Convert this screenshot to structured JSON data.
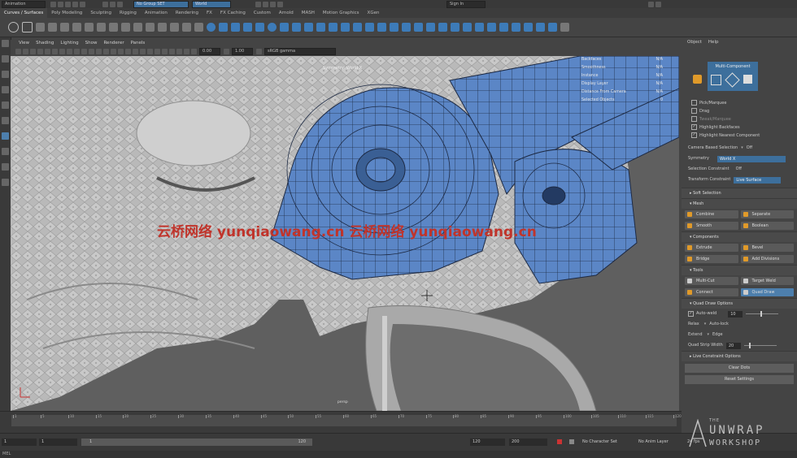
{
  "status": {
    "mode": "Animation",
    "selection_set": "No Group SET",
    "space": "World",
    "sign_in": "Sign In"
  },
  "shelf_tabs": [
    "Curves / Surfaces",
    "Poly Modeling",
    "Sculpting",
    "Rigging",
    "Animation",
    "Rendering",
    "FX",
    "FX Caching",
    "Custom",
    "Arnold",
    "MASH",
    "Motion Graphics",
    "XGen"
  ],
  "viewport_menu": [
    "View",
    "Shading",
    "Lighting",
    "Show",
    "Renderer",
    "Panels"
  ],
  "viewport_toolbar": {
    "value1": "0.00",
    "value2": "1.00",
    "color_space": "sRGB gamma"
  },
  "hud": [
    {
      "label": "Backfaces",
      "value": "N/A"
    },
    {
      "label": "Smoothness",
      "value": "N/A"
    },
    {
      "label": "Instance",
      "value": "N/A"
    },
    {
      "label": "Display Layer",
      "value": "N/A"
    },
    {
      "label": "Distance From Camera",
      "value": "N/A"
    },
    {
      "label": "Selected Objects",
      "value": "0"
    }
  ],
  "symmetry_label": "Symmetry: World X",
  "camera_name": "persp",
  "watermark": "云桥网络 yunqiaowang.cn 云桥网络 yunqiaowang.cn",
  "panel": {
    "menu": [
      "Object",
      "Help"
    ],
    "mode_title": "Multi-Component",
    "pick_options": [
      {
        "label": "Pick/Marquee",
        "checked": false,
        "dim": false
      },
      {
        "label": "Drag",
        "checked": false,
        "dim": false
      },
      {
        "label": "Tweak/Marquee",
        "checked": false,
        "dim": true
      },
      {
        "label": "Highlight Backfaces",
        "checked": true,
        "dim": false
      },
      {
        "label": "Highlight Nearest Component",
        "checked": true,
        "dim": false
      }
    ],
    "camera_based": {
      "label": "Camera Based Selection",
      "value": "Off"
    },
    "symmetry": {
      "label": "Symmetry",
      "value": "World X"
    },
    "selection_constraint": {
      "label": "Selection Constraint",
      "value": "Off"
    },
    "transform_constraint": {
      "label": "Transform Constraint",
      "value": "Live Surface"
    },
    "soft_selection": "Soft Selection",
    "mesh": {
      "title": "Mesh",
      "buttons": [
        "Combine",
        "Separate",
        "Smooth",
        "Boolean"
      ]
    },
    "components": {
      "title": "Components",
      "buttons": [
        "Extrude",
        "Bevel",
        "Bridge",
        "Add Divisions"
      ]
    },
    "tools": {
      "title": "Tools",
      "buttons": [
        "Multi-Cut",
        "Target Weld",
        "Connect",
        "Quad Draw"
      ]
    },
    "quad_draw": {
      "title": "Quad Draw Options",
      "auto_weld_label": "Auto-weld",
      "auto_weld_value": "10",
      "relax_label": "Relax",
      "relax_value": "Auto-lock",
      "extend_label": "Extend",
      "extend_value": "Edge",
      "strip_label": "Quad Strip Width",
      "strip_value": "20"
    },
    "live_constraint": "Live Constraint Options",
    "clear_dots": "Clear Dots",
    "reset_settings": "Reset Settings"
  },
  "timeline": {
    "ticks": [
      "1",
      "5",
      "10",
      "15",
      "20",
      "25",
      "30",
      "35",
      "40",
      "45",
      "50",
      "55",
      "60",
      "65",
      "70",
      "75",
      "80",
      "85",
      "90",
      "95",
      "100",
      "105",
      "110",
      "115",
      "120"
    ],
    "range_start": "1",
    "anim_start": "1",
    "slider_start": "1",
    "slider_end": "120",
    "range_end": "120",
    "anim_end": "200",
    "character_set": "No Character Set",
    "anim_layer": "No Anim Layer",
    "fps": "24 fps"
  },
  "command_line": "MEL",
  "logo": {
    "line1": "THE",
    "line2": "UNWRAP",
    "line3": "WORKSHOP"
  }
}
